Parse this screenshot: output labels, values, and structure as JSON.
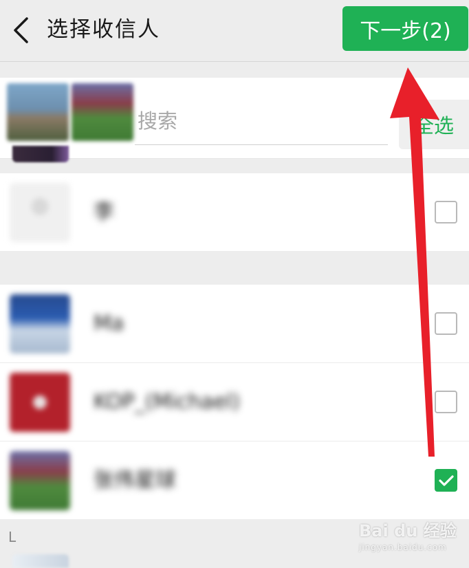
{
  "header": {
    "title": "选择收信人",
    "next_button": "下一步(2)"
  },
  "search": {
    "placeholder": "搜索",
    "select_all": "全选"
  },
  "contacts": [
    {
      "name": "李",
      "checked": false
    },
    {
      "name": "Ma",
      "checked": false
    },
    {
      "name": "KOP_(Michael)",
      "checked": false
    },
    {
      "name": "张伟星球",
      "checked": true
    }
  ],
  "sections": [
    {
      "letter": "L"
    }
  ],
  "watermark": {
    "main": "Bai du 经验",
    "sub": "jingyan.baidu.com"
  },
  "colors": {
    "accent": "#1fb155",
    "arrow": "#e8202a",
    "background": "#ededed"
  }
}
